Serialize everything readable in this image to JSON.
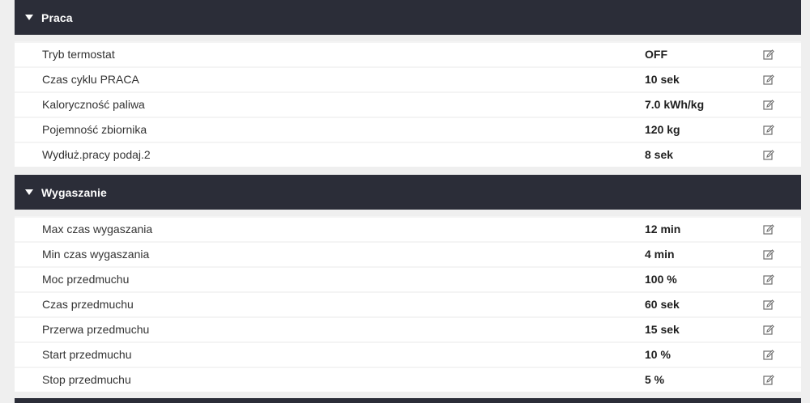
{
  "sections": [
    {
      "title": "Praca",
      "rows": [
        {
          "label": "Tryb termostat",
          "value": "OFF"
        },
        {
          "label": "Czas cyklu PRACA",
          "value": "10 sek"
        },
        {
          "label": "Kaloryczność paliwa",
          "value": "7.0 kWh/kg"
        },
        {
          "label": "Pojemność zbiornika",
          "value": "120 kg"
        },
        {
          "label": "Wydłuż.pracy podaj.2",
          "value": "8 sek"
        }
      ]
    },
    {
      "title": "Wygaszanie",
      "rows": [
        {
          "label": "Max czas wygaszania",
          "value": "12 min"
        },
        {
          "label": "Min czas wygaszania",
          "value": "4 min"
        },
        {
          "label": "Moc przedmuchu",
          "value": "100 %"
        },
        {
          "label": "Czas przedmuchu",
          "value": "60 sek"
        },
        {
          "label": "Przerwa przedmuchu",
          "value": "15 sek"
        },
        {
          "label": "Start przedmuchu",
          "value": "10 %"
        },
        {
          "label": "Stop przedmuchu",
          "value": "5 %"
        }
      ]
    }
  ],
  "icons": {
    "section_toggle": "caret-down-icon",
    "row_edit": "edit-icon"
  },
  "colors": {
    "header_bg": "#2b2d38",
    "header_text": "#ffffff",
    "page_bg": "#efefef",
    "row_bg": "#ffffff",
    "edit_icon": "#6f6f6f"
  }
}
